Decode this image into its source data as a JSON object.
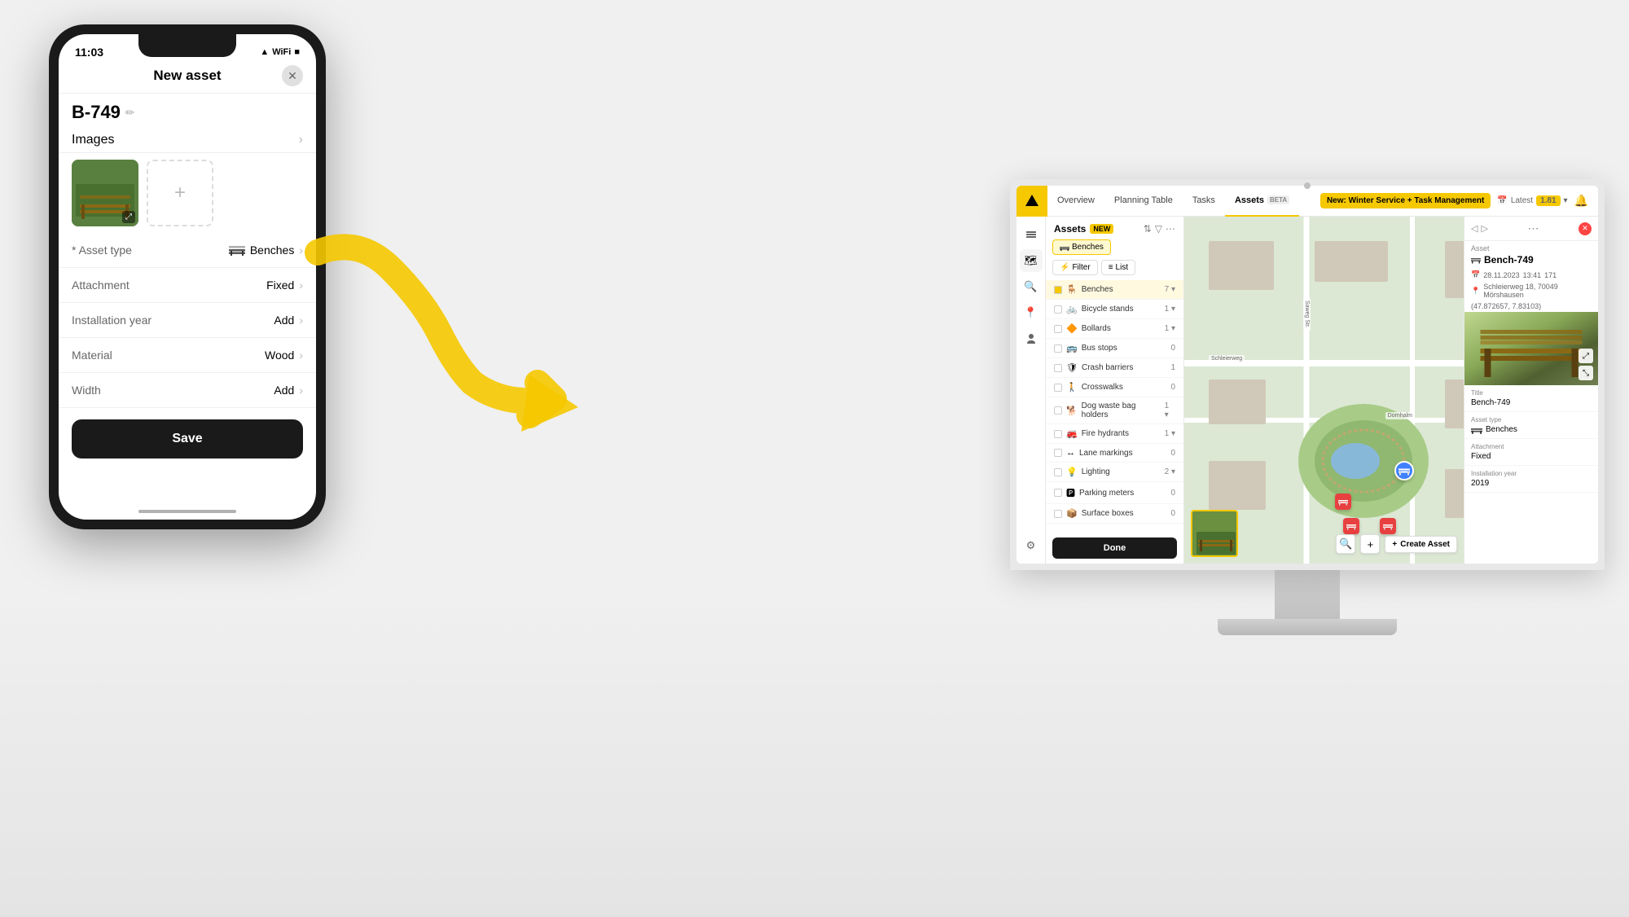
{
  "phone": {
    "status_time": "11:03",
    "title": "New asset",
    "asset_id": "B-749",
    "images_label": "Images",
    "fields": [
      {
        "label": "Asset type",
        "value": "Benches",
        "required": true,
        "type": "select"
      },
      {
        "label": "Attachment",
        "value": "Fixed",
        "required": false,
        "type": "value"
      },
      {
        "label": "Installation year",
        "value": "Add",
        "required": false,
        "type": "add"
      },
      {
        "label": "Material",
        "value": "Wood",
        "required": false,
        "type": "value"
      },
      {
        "label": "Width",
        "value": "Add",
        "required": false,
        "type": "add"
      }
    ],
    "save_label": "Save"
  },
  "app": {
    "nav_items": [
      "Overview",
      "Planning Table",
      "Tasks",
      "Assets"
    ],
    "assets_beta": "BETA",
    "new_feature_label": "New: Winter Service + Task Management",
    "latest_label": "Latest",
    "km_value": "1.81",
    "assets_panel_title": "Assets",
    "assets_panel_badge": "NEW",
    "filter_label": "Filter",
    "list_label": "List",
    "asset_types": [
      {
        "name": "Benches",
        "count": "7 ▾",
        "checked": true
      },
      {
        "name": "Bicycle stands",
        "count": "1 ▾",
        "checked": false
      },
      {
        "name": "Bollards",
        "count": "1 ▾",
        "checked": false
      },
      {
        "name": "Bus stops",
        "count": "0",
        "checked": false
      },
      {
        "name": "Crash barriers",
        "count": "1",
        "checked": false
      },
      {
        "name": "Crosswalks",
        "count": "0",
        "checked": false
      },
      {
        "name": "Dog waste bag holders",
        "count": "1 ▾",
        "checked": false
      },
      {
        "name": "Fire hydrants",
        "count": "1 ▾",
        "checked": false
      },
      {
        "name": "Lane markings",
        "count": "0",
        "checked": false
      },
      {
        "name": "Lighting",
        "count": "2 ▾",
        "checked": false
      },
      {
        "name": "Parking meters",
        "count": "0",
        "checked": false
      },
      {
        "name": "Surface boxes",
        "count": "0",
        "checked": false
      }
    ],
    "done_label": "Done",
    "detail": {
      "asset_label": "Asset",
      "asset_id": "⊞ Bench-749",
      "date": "28.11.2023",
      "time": "13:41",
      "id_num": "171",
      "address": "Schleierweg 18, 70049 Mörshausen",
      "coords": "(47.872657, 7.83103)",
      "title_label": "Title",
      "title_value": "Bench-749",
      "asset_type_label": "Asset type",
      "asset_type_value": "Benches",
      "attachment_label": "Attachment",
      "attachment_value": "Fixed",
      "installation_year_label": "Installation year",
      "installation_year_value": "2019"
    },
    "map": {
      "create_asset_label": "Create Asset",
      "street_labels": [
        "Schleierweg",
        "Dornhalm",
        "Saweg Str."
      ]
    }
  }
}
